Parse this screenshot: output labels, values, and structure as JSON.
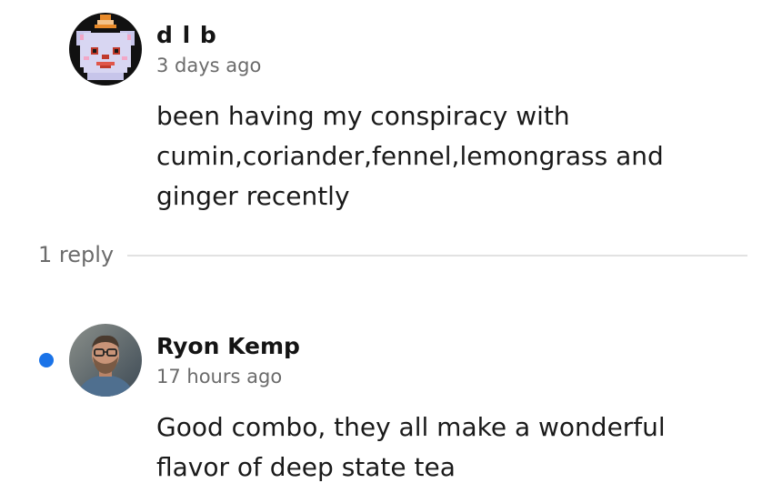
{
  "colors": {
    "unread_dot": "#1a73e8",
    "time_text": "#6b6b6b",
    "divider": "#e2e2e2"
  },
  "comments": [
    {
      "author": "dlb",
      "author_display": "d l b",
      "time": "3 days ago",
      "avatar_icon": "pixel-bear-avatar",
      "body_lines": [
        "been having my conspiracy with",
        "cumin,coriander,fennel,lemongrass and",
        "ginger recently"
      ]
    },
    {
      "author": "Ryon Kemp",
      "time": "17 hours ago",
      "avatar_icon": "user-photo-avatar",
      "unread": true,
      "body_lines": [
        "Good combo, they all make a wonderful",
        "flavor of deep state tea"
      ]
    }
  ],
  "replies": {
    "label": "1 reply"
  }
}
